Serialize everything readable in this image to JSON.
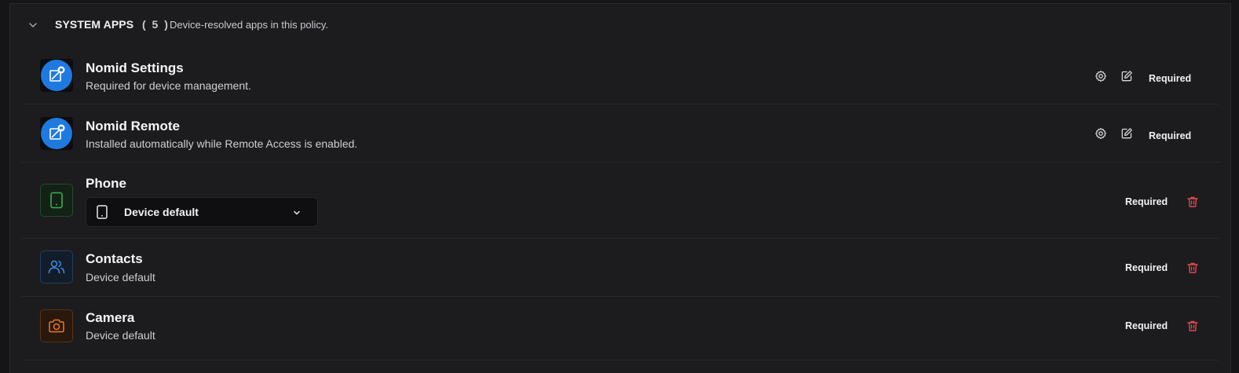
{
  "section": {
    "title": "SYSTEM APPS",
    "count": "( 5 )",
    "description": "Device-resolved apps in this policy."
  },
  "apps": [
    {
      "name": "Nomid Settings",
      "subtitle": "Required for device management.",
      "status": "Required",
      "icon": "nomid-settings-icon"
    },
    {
      "name": "Nomid Remote",
      "subtitle": "Installed automatically while Remote Access is enabled.",
      "status": "Required",
      "icon": "nomid-remote-icon"
    },
    {
      "name": "Phone",
      "select_value": "Device default",
      "status": "Required",
      "icon": "phone-icon"
    },
    {
      "name": "Contacts",
      "subtitle": "Device default",
      "status": "Required",
      "icon": "contacts-icon"
    },
    {
      "name": "Camera",
      "subtitle": "Device default",
      "status": "Required",
      "icon": "camera-icon"
    }
  ],
  "colors": {
    "background": "#1c1c1f",
    "nomid_blue": "#1f7ae0",
    "phone_green": "#33b34a",
    "contacts_blue": "#3f8ee8",
    "camera_orange": "#f07b1c",
    "delete_red": "#e5484d"
  }
}
